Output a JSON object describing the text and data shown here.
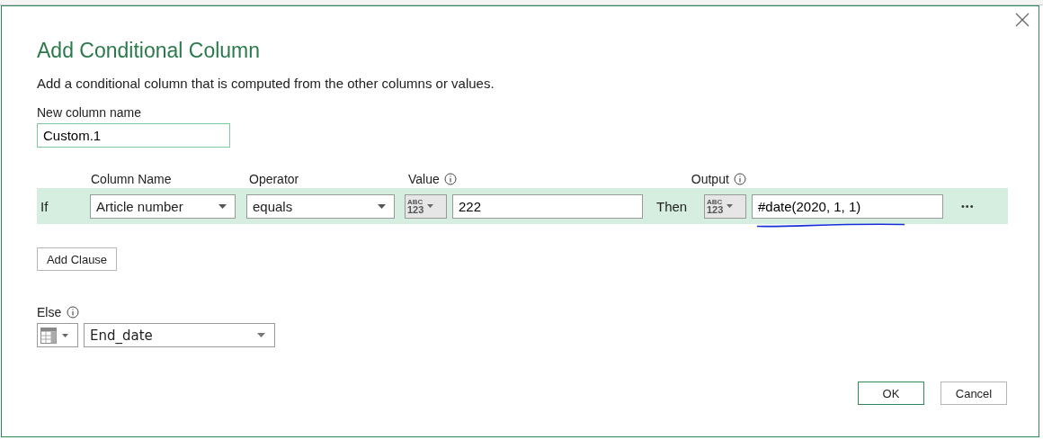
{
  "dialog": {
    "title": "Add Conditional Column",
    "description": "Add a conditional column that is computed from the other columns or values."
  },
  "new_column": {
    "label": "New column name",
    "value": "Custom.1"
  },
  "headers": {
    "column_name": "Column Name",
    "operator": "Operator",
    "value": "Value",
    "output": "Output"
  },
  "clauses": [
    {
      "if_label": "If",
      "column": "Article number",
      "operator": "equals",
      "value_type": [
        "ABC",
        "123"
      ],
      "value": "222",
      "then_label": "Then",
      "output_type": [
        "ABC",
        "123"
      ],
      "output": "#date(2020, 1, 1)",
      "more": "•••",
      "underlined": true
    }
  ],
  "add_clause": "Add Clause",
  "else": {
    "label": "Else",
    "value": "End_date"
  },
  "buttons": [
    {
      "label": "OK",
      "primary": true
    },
    {
      "label": "Cancel",
      "primary": false
    }
  ]
}
